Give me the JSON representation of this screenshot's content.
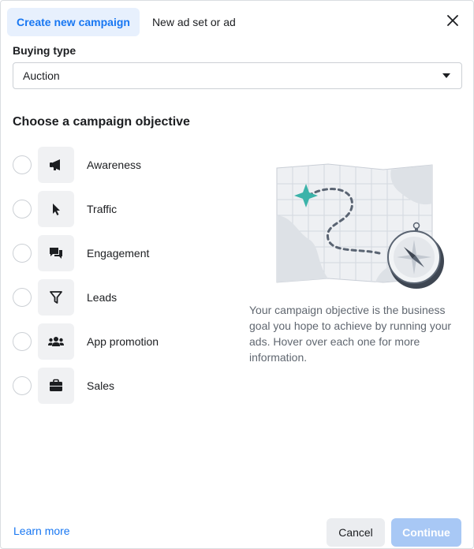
{
  "tabs": [
    {
      "label": "Create new campaign",
      "active": true
    },
    {
      "label": "New ad set or ad",
      "active": false
    }
  ],
  "buying_type": {
    "label": "Buying type",
    "selected": "Auction"
  },
  "objective_heading": "Choose a campaign objective",
  "objectives": [
    {
      "label": "Awareness",
      "icon": "megaphone-icon"
    },
    {
      "label": "Traffic",
      "icon": "cursor-icon"
    },
    {
      "label": "Engagement",
      "icon": "chat-bubbles-icon"
    },
    {
      "label": "Leads",
      "icon": "filter-icon"
    },
    {
      "label": "App promotion",
      "icon": "people-icon"
    },
    {
      "label": "Sales",
      "icon": "briefcase-icon"
    }
  ],
  "description": "Your campaign objective is the business goal you hope to achieve by running your ads. Hover over each one for more information.",
  "footer": {
    "learn_more": "Learn more",
    "cancel": "Cancel",
    "continue": "Continue"
  },
  "colors": {
    "accent": "#1877f2",
    "accent_bg": "#e7f0fd",
    "continue_disabled": "#a8c8f5",
    "map_star": "#3bb3a9"
  }
}
